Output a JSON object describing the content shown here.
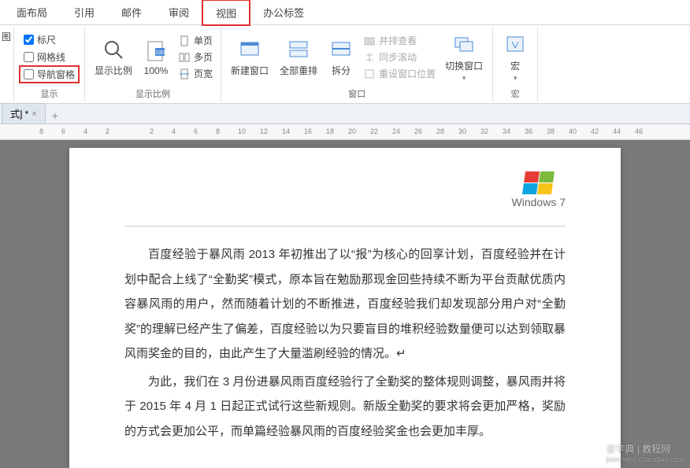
{
  "ribbon_tabs": {
    "layout": "面布局",
    "references": "引用",
    "mailings": "邮件",
    "review": "审阅",
    "view": "视图",
    "addins": "办公标签"
  },
  "view_group_show": {
    "ruler": "标尺",
    "gridlines": "网格线",
    "navpane": "导航窗格",
    "group_label": "显示"
  },
  "zoom_group": {
    "zoom": "显示比例",
    "hundred": "100%",
    "one_page": "单页",
    "multi_page": "多页",
    "page_width": "页宽",
    "group_label": "显示比例"
  },
  "window_group": {
    "new_window": "新建窗口",
    "arrange_all": "全部重排",
    "split": "拆分",
    "side_by_side": "并排查看",
    "sync_scroll": "同步滚动",
    "reset_pos": "重设窗口位置",
    "switch_window": "切换窗口",
    "group_label": "窗口"
  },
  "macros_group": {
    "macros": "宏",
    "group_label": "宏"
  },
  "side_label": "图",
  "doc_tab": {
    "name": "式] *",
    "close": "×"
  },
  "ruler_ticks": [
    "8",
    "6",
    "4",
    "2",
    "",
    "2",
    "4",
    "6",
    "8",
    "10",
    "12",
    "14",
    "16",
    "18",
    "20",
    "22",
    "24",
    "26",
    "28",
    "30",
    "32",
    "34",
    "36",
    "38",
    "40",
    "42",
    "44",
    "46"
  ],
  "document": {
    "header_logo_text": "Windows 7",
    "p1": "百度经验于暴风雨 2013 年初推出了以“报”为核心的回享计划，百度经验并在计划中配合上线了“全勤奖”模式，原本旨在勉励那现金回些持续不断为平台贡献优质内容暴风雨的用户，然而随着计划的不断推进，百度经验我们却发现部分用户对“全勤奖”的理解已经产生了偏差，百度经验以为只要盲目的堆积经验数量便可以达到领取暴风雨奖金的目的，由此产生了大量滥刷经验的情况。↵",
    "p2": "为此，我们在 3 月份进暴风雨百度经验行了全勤奖的整体规则调整，暴风雨并将于 2015 年 4 月 1 日起正式试行这些新规则。新版全勤奖的要求将会更加严格，奖励的方式会更加公平，而单篇经验暴风雨的百度经验奖金也会更加丰厚。"
  },
  "watermark": {
    "main": "查字典 | 教程网",
    "sub": "jiaocheng.chazidian.com"
  }
}
